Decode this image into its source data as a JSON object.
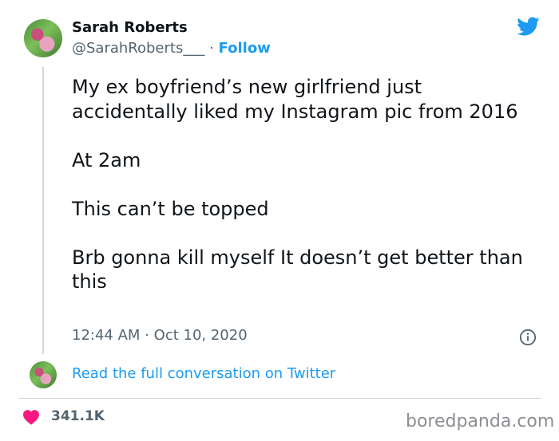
{
  "author": {
    "display_name": "Sarah Roberts",
    "handle": "@SarahRoberts___",
    "separator": "·",
    "follow_label": "Follow",
    "avatar_icon": "profile-photo-icon"
  },
  "tweet": {
    "lines": [
      "My ex boyfriend’s new girlfriend just accidentally liked my Instagram pic from 2016",
      "At 2am",
      "This can’t be topped",
      "Brb gonna kill myself It doesn’t get better than this"
    ],
    "time": "12:44 AM",
    "separator": "·",
    "date": "Oct 10, 2020"
  },
  "conversation_link": "Read the full conversation on Twitter",
  "engagement": {
    "likes": "341.1K",
    "heart_color": "#f91880"
  },
  "watermark": "boredpanda.com",
  "colors": {
    "twitter_blue": "#1d9bf0",
    "text_primary": "#0f1419",
    "text_secondary": "#536471"
  }
}
